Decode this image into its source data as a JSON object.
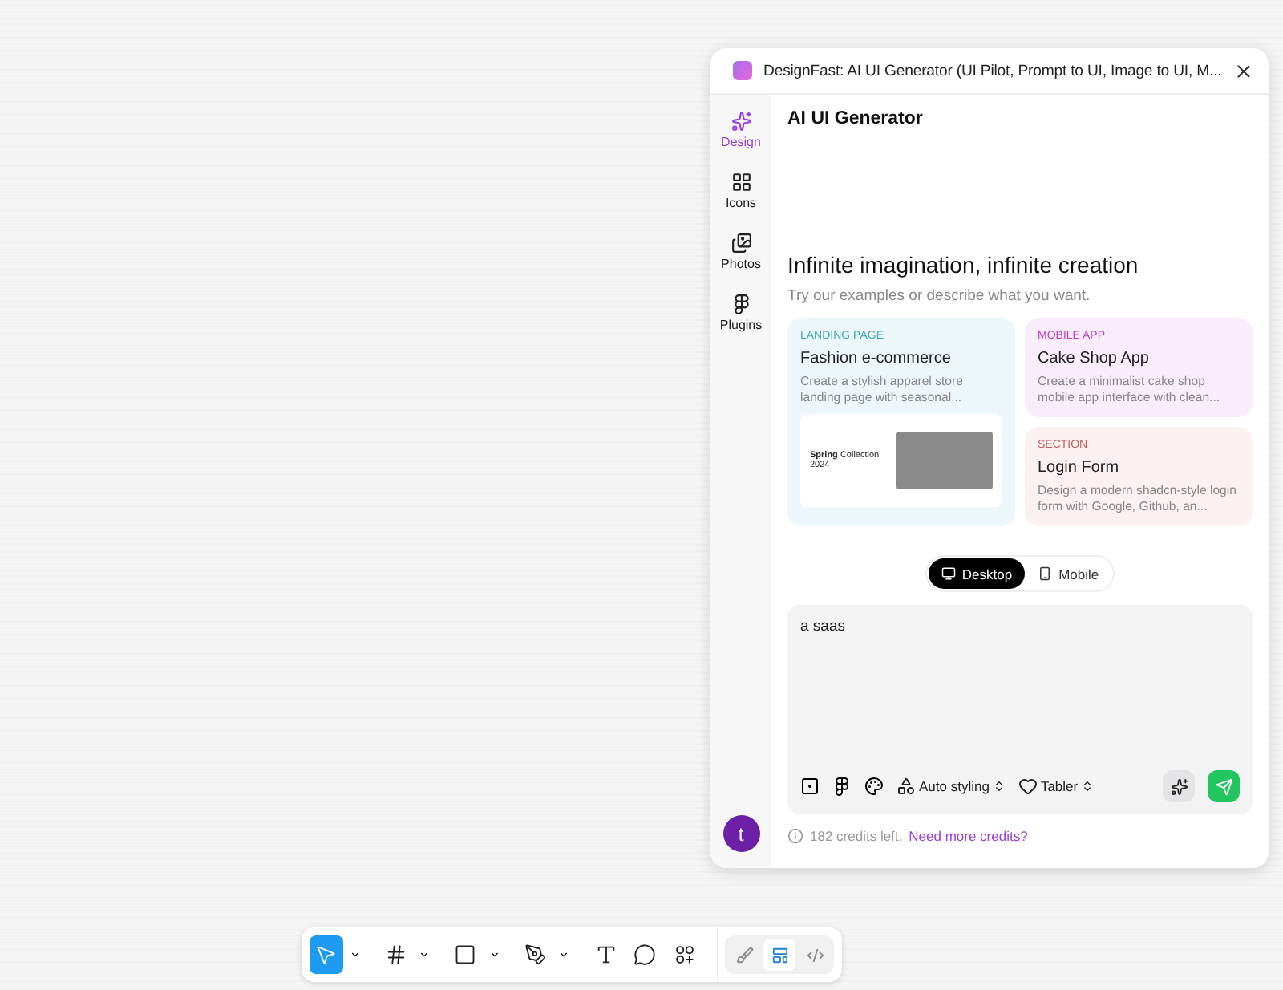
{
  "window": {
    "title": "DesignFast: AI UI Generator (UI Pilot, Prompt to UI, Image to UI, M..."
  },
  "sidebar": {
    "items": [
      {
        "label": "Design",
        "selected": true
      },
      {
        "label": "Icons",
        "selected": false
      },
      {
        "label": "Photos",
        "selected": false
      },
      {
        "label": "Plugins",
        "selected": false
      }
    ],
    "avatar": "t"
  },
  "header": {
    "title": "AI UI Generator"
  },
  "hero": {
    "title": "Infinite imagination, infinite creation",
    "subtitle": "Try our examples or describe what you want."
  },
  "examples": [
    {
      "category": "LANDING PAGE",
      "color": "#3ba8bd",
      "title": "Fashion e-commerce",
      "description": "Create a stylish apparel store landing page with seasonal...",
      "preview": "**Spring** Collection 2024"
    },
    {
      "category": "MOBILE APP",
      "color": "#c13ad1",
      "title": "Cake Shop App",
      "description": "Create a minimalist cake shop mobile app interface with clean..."
    },
    {
      "category": "SECTION",
      "color": "#c4605a",
      "title": "Login Form",
      "description": "Design a modern shadcn-style login form with Google, Github, an..."
    }
  ],
  "device_toggle": [
    {
      "label": "Desktop",
      "selected": true
    },
    {
      "label": "Mobile",
      "selected": false
    }
  ],
  "prompt": {
    "value": "a saas",
    "style_select": "Auto styling",
    "icon_select": "Tabler"
  },
  "credits": {
    "text": "182 credits left.",
    "link": "Need more credits?"
  },
  "toolbar": {
    "tools": [
      {
        "selected": true,
        "dropdown": true
      },
      {
        "selected": false,
        "dropdown": true
      },
      {
        "selected": false,
        "dropdown": true
      },
      {
        "selected": false,
        "dropdown": true
      },
      {
        "selected": false,
        "dropdown": false
      },
      {
        "selected": false,
        "dropdown": false
      },
      {
        "selected": false,
        "dropdown": false
      }
    ],
    "modes": [
      {
        "selected": false
      },
      {
        "selected": true
      },
      {
        "selected": false
      }
    ]
  }
}
